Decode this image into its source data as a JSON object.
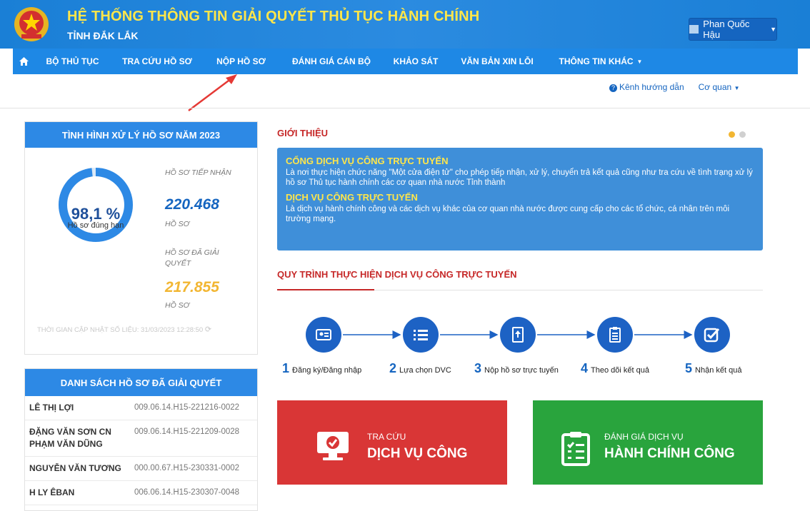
{
  "header": {
    "title": "HỆ THỐNG THÔNG TIN GIẢI QUYẾT THỦ TỤC HÀNH CHÍNH",
    "subtitle": "TỈNH ĐẮK LẮK",
    "user": "Phan Quốc Hậu",
    "title_color": "#ffe64a"
  },
  "nav": {
    "items": [
      {
        "label": "BỘ THỦ TỤC"
      },
      {
        "label": "TRA CỨU HỒ SƠ"
      },
      {
        "label": "NỘP HỒ SƠ"
      },
      {
        "label": "ĐÁNH GIÁ CÁN BỘ"
      },
      {
        "label": "KHẢO SÁT"
      },
      {
        "label": "VĂN BẢN XIN LỖI"
      },
      {
        "label": "THÔNG TIN KHÁC"
      }
    ]
  },
  "subnav": {
    "guide": "Kênh hướng dẫn",
    "agency": "Cơ quan"
  },
  "stats": {
    "title": "TÌNH HÌNH XỬ LÝ HỒ SƠ NĂM 2023",
    "percent": "98,1 %",
    "percent_value": 98.1,
    "percent_label": "Hồ sơ đúng hạn",
    "received_label": "HỒ SƠ TIẾP NHẬN",
    "received_value": "220.468",
    "received_unit": "HỒ SƠ",
    "resolved_label": "HỒ SƠ ĐÃ GIẢI QUYẾT",
    "resolved_value": "217.855",
    "resolved_unit": "HỒ SƠ",
    "updated": "THỜI GIAN CẬP NHẬT SỐ LIỆU: 31/03/2023 12:28:50",
    "colors": {
      "received": "#1565c0",
      "resolved": "#f2b632",
      "donut": "#2d89e5"
    }
  },
  "resolved_list": {
    "title": "DANH SÁCH HỒ SƠ ĐÃ GIẢI QUYẾT",
    "rows": [
      {
        "name": "LÊ THỊ LỢI",
        "code": "009.06.14.H15-221216-0022"
      },
      {
        "name": "ĐẶNG VĂN SƠN CN PHẠM VĂN DŨNG",
        "code": "009.06.14.H15-221209-0028"
      },
      {
        "name": "NGUYỄN VĂN TƯƠNG",
        "code": "000.00.67.H15-230331-0002"
      },
      {
        "name": "H LY ÊBAN",
        "code": "006.06.14.H15-230307-0048"
      }
    ]
  },
  "intro": {
    "title": "GIỚI THIỆU",
    "h1": "CỔNG DỊCH VỤ CÔNG TRỰC TUYẾN",
    "t1": "Là nơi thực hiện chức năng \"Một cửa điện tử\" cho phép tiếp nhận, xử lý, chuyển trả kết quả cũng như tra cứu về tình trạng xử lý hồ sơ Thủ tục hành chính các cơ quan nhà nước Tỉnh thành",
    "h2": "DỊCH VỤ CÔNG TRỰC TUYẾN",
    "t2": "Là dịch vụ hành chính công và các dịch vụ khác của cơ quan nhà nước được cung cấp cho các tổ chức, cá nhân trên môi trường mạng."
  },
  "process": {
    "title": "QUY TRÌNH THỰC HIỆN DỊCH VỤ CÔNG TRỰC TUYẾN",
    "steps": [
      {
        "num": "1",
        "label": "Đăng ký/Đăng nhập",
        "icon": "id-card-icon"
      },
      {
        "num": "2",
        "label": "Lựa chọn DVC",
        "icon": "list-icon"
      },
      {
        "num": "3",
        "label": "Nộp hồ sơ trực tuyến",
        "icon": "upload-doc-icon"
      },
      {
        "num": "4",
        "label": "Theo dõi kết quả",
        "icon": "checklist-icon"
      },
      {
        "num": "5",
        "label": "Nhận kết quả",
        "icon": "check-square-icon"
      }
    ]
  },
  "cards": {
    "search_t1": "TRA CỨU",
    "search_t2": "DỊCH VỤ CÔNG",
    "rate_t1": "ĐÁNH GIÁ DỊCH VỤ",
    "rate_t2": "HÀNH CHÍNH CÔNG"
  }
}
